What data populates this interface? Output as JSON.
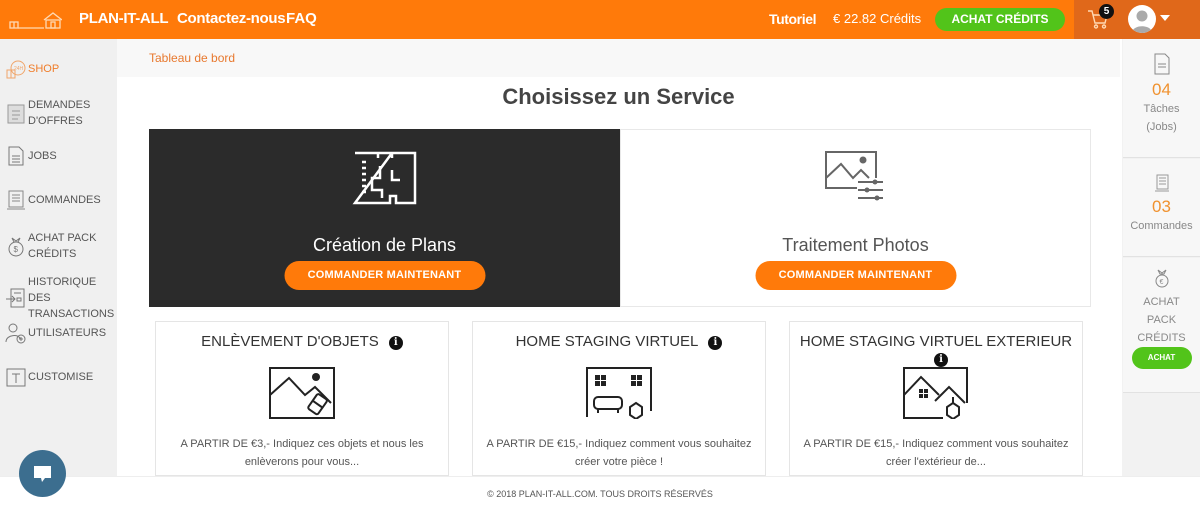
{
  "header": {
    "brand": "PLAN-IT-ALL",
    "nav": {
      "contact": "Contactez-nous",
      "faq": "FAQ"
    },
    "tutoriel": "Tutoriel",
    "credits": "€ 22.82 Crédits",
    "buy_credits_label": "ACHAT CRÉDITS",
    "cart_count": "5",
    "icons": {
      "logo": "house-logo-icon",
      "cart": "cart-icon",
      "avatar": "user-avatar-icon",
      "caret": "caret-down-icon"
    },
    "colors": {
      "bar": "#ff7a0a",
      "user_zone": "#e0681a",
      "buy_button": "#52c41a"
    }
  },
  "sidebar": {
    "items": [
      {
        "label": "SHOP",
        "icon": "shop-24h-icon",
        "active": true
      },
      {
        "label": "DEMANDES D'OFFRES",
        "icon": "clipboard-icon"
      },
      {
        "label": "JOBS",
        "icon": "document-icon"
      },
      {
        "label": "COMMANDES",
        "icon": "receipt-icon"
      },
      {
        "label": "ACHAT PACK CRÉDITS",
        "icon": "money-bag-icon"
      },
      {
        "label": "HISTORIQUE DES TRANSACTIONS",
        "icon": "transactions-icon"
      },
      {
        "label": "UTILISATEURS",
        "icon": "add-user-icon"
      },
      {
        "label": "CUSTOMISE",
        "icon": "customise-icon"
      }
    ]
  },
  "breadcrumb": "Tableau de bord",
  "main": {
    "title": "Choisissez un Service",
    "big_services": [
      {
        "title": "Création de Plans",
        "button": "COMMANDER MAINTENANT",
        "icon": "floor-plan-icon"
      },
      {
        "title": "Traitement Photos",
        "button": "COMMANDER MAINTENANT",
        "icon": "photo-adjust-icon"
      }
    ],
    "small_services": [
      {
        "title": "ENLÈVEMENT D'OBJETS",
        "info": "i",
        "desc": "A PARTIR DE €3,- Indiquez ces objets et nous les enlèverons pour vous...",
        "icon": "object-removal-icon"
      },
      {
        "title": "HOME STAGING VIRTUEL",
        "info": "i",
        "desc": "A PARTIR DE €15,- Indiquez comment vous souhaitez créer votre pièce !",
        "icon": "virtual-staging-icon"
      },
      {
        "title": "HOME STAGING VIRTUEL EXTERIEUR",
        "info": "i",
        "desc": "A PARTIR DE €15,- Indiquez comment vous souhaitez créer l'extérieur de...",
        "icon": "exterior-staging-icon"
      }
    ]
  },
  "right_panel": {
    "tasks": {
      "count": "04",
      "label1": "Tâches",
      "label2": "(Jobs)"
    },
    "orders": {
      "count": "03",
      "label": "Commandes"
    },
    "pack": {
      "line1": "ACHAT",
      "line2": "PACK",
      "line3": "CRÉDITS",
      "button": "ACHAT"
    }
  },
  "footer": {
    "copyright": "© 2018 PLAN-IT-ALL.COM. TOUS DROITS RÉSERVÉS"
  }
}
